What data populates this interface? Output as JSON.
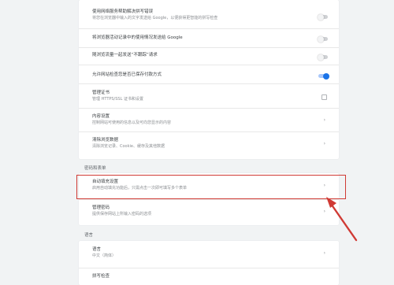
{
  "privacy": {
    "rows": [
      {
        "title": "使用网络服务帮助解决拼写错误",
        "subtitle": "将您在浏览器中输入的文字发送给 Google，以便获得更智能的拼写检查",
        "control": "toggle",
        "on": false
      },
      {
        "title": "将浏览器活动记录中的使用情况发送给 Google",
        "subtitle": "",
        "control": "toggle",
        "on": false
      },
      {
        "title": "随浏览流量一起发送“不跟踪”请求",
        "subtitle": "",
        "control": "toggle",
        "on": false
      },
      {
        "title": "允许网站检查您是否已保存付款方式",
        "subtitle": "",
        "control": "toggle",
        "on": true
      },
      {
        "title": "管理证书",
        "subtitle": "管理 HTTPS/SSL 证书和设置",
        "control": "external"
      },
      {
        "title": "内容设置",
        "subtitle": "控制网站可使用的信息以及可向您显示的内容",
        "control": "chevron"
      },
      {
        "title": "清除浏览数据",
        "subtitle": "清除浏览记录、Cookie、缓存及其他数据",
        "control": "chevron"
      }
    ]
  },
  "passwords_section": {
    "title": "密码和表单",
    "rows": [
      {
        "title": "自动填充设置",
        "subtitle": "启用自动填充功能后，只需点击一次即可填写多个表单",
        "control": "chevron"
      },
      {
        "title": "管理密码",
        "subtitle": "提供保存网站上所输入密码的选项",
        "control": "chevron"
      }
    ]
  },
  "language_section": {
    "title": "语言",
    "rows": [
      {
        "title": "语言",
        "subtitle": "中文（简体）",
        "control": "chevron"
      },
      {
        "title": "拼写检查",
        "subtitle": "",
        "control": "none"
      }
    ]
  },
  "colors": {
    "highlight": "#d03a34",
    "accent": "#1a73e8"
  },
  "icons": {
    "chevron": "›",
    "external": "external-link-icon",
    "arrow": "annotation-arrow-icon"
  }
}
